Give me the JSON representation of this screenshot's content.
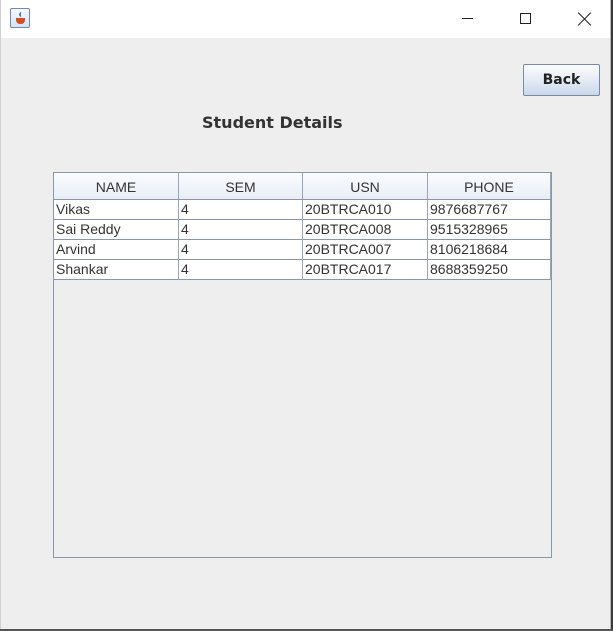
{
  "window": {
    "title": ""
  },
  "titlebar": {
    "icons": [
      "java-app-icon",
      "minimize-icon",
      "maximize-icon",
      "close-icon"
    ]
  },
  "toolbar": {
    "back_label": "Back"
  },
  "page": {
    "title": "Student Details"
  },
  "table": {
    "columns": [
      "NAME",
      "SEM",
      "USN",
      "PHONE"
    ],
    "rows": [
      [
        "Vikas",
        "4",
        "20BTRCA010",
        "9876687767"
      ],
      [
        "Sai Reddy",
        "4",
        "20BTRCA008",
        "9515328965"
      ],
      [
        "Arvind",
        "4",
        "20BTRCA007",
        "8106218684"
      ],
      [
        "Shankar",
        "4",
        "20BTRCA017",
        "8688359250"
      ]
    ]
  },
  "colors": {
    "window_bg": "#eeeeee",
    "titlebar_bg": "#ffffff",
    "grid_line": "#8a97a8",
    "text": "#333333"
  }
}
